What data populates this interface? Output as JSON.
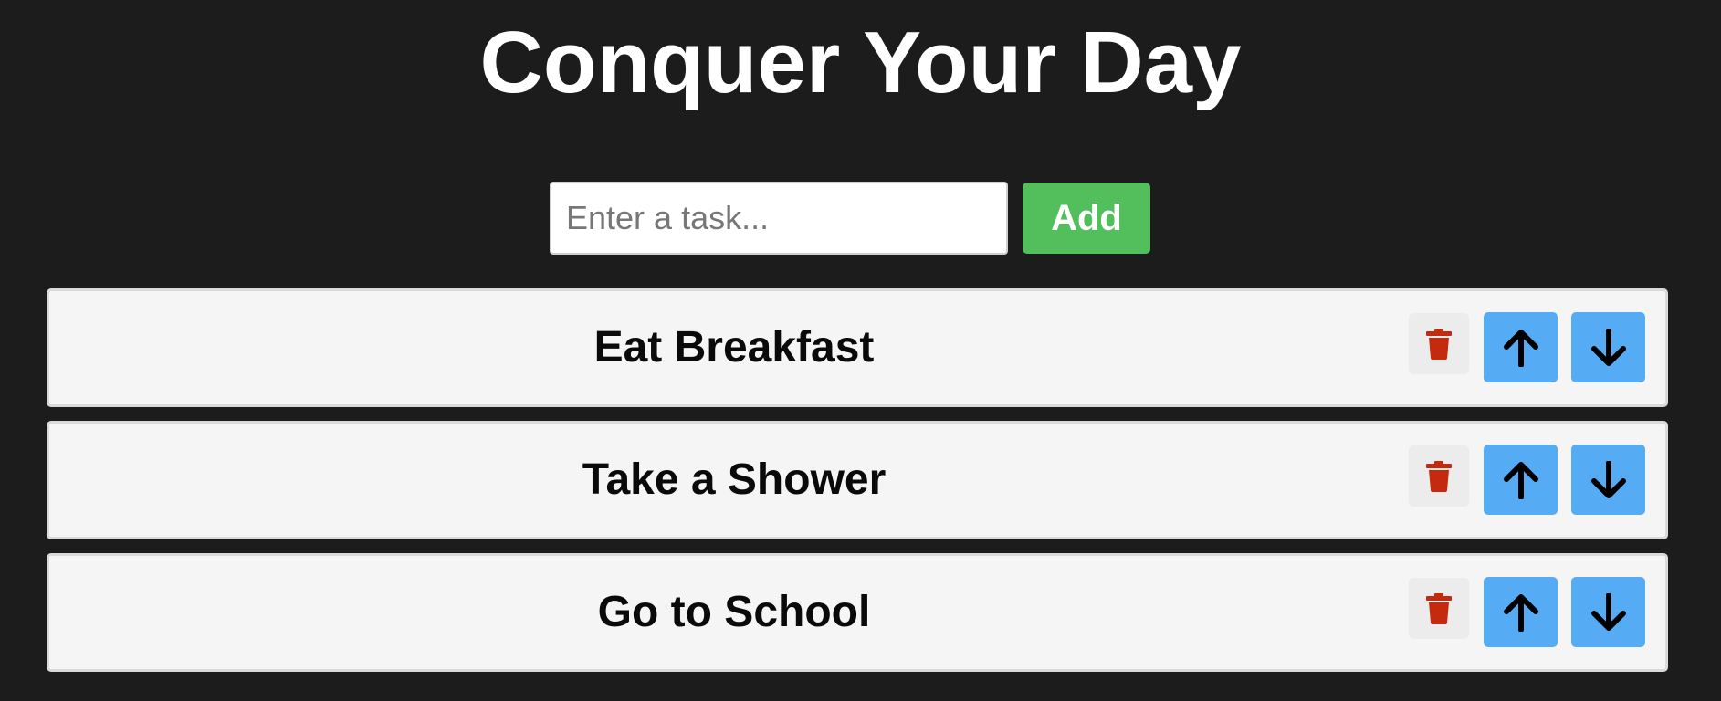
{
  "header": {
    "title": "Conquer Your Day"
  },
  "add_form": {
    "placeholder": "Enter a task...",
    "value": "",
    "add_label": "Add"
  },
  "tasks": [
    {
      "label": "Eat Breakfast"
    },
    {
      "label": "Take a Shower"
    },
    {
      "label": "Go to School"
    }
  ],
  "icons": {
    "delete": "trash-icon",
    "move_up": "arrow-up-icon",
    "move_down": "arrow-down-icon"
  },
  "colors": {
    "background": "#1c1c1c",
    "add_button": "#52be5c",
    "move_button": "#55acf5",
    "delete_icon": "#c42a0d",
    "task_background": "#f5f5f5"
  }
}
